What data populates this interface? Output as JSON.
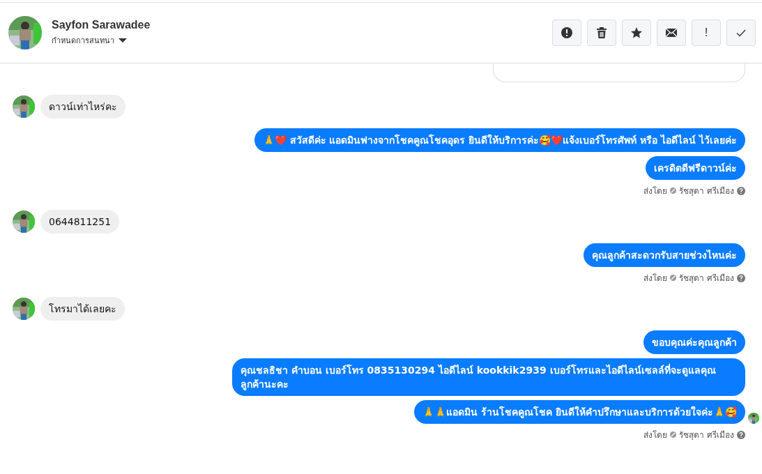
{
  "header": {
    "contact_name": "Sayfon Sarawadee",
    "subtitle": "กำหนดการสนทนา",
    "actions": [
      {
        "kind": "report"
      },
      {
        "kind": "trash"
      },
      {
        "kind": "star"
      },
      {
        "kind": "mail"
      },
      {
        "kind": "exclaim",
        "label": "!"
      },
      {
        "kind": "check"
      }
    ]
  },
  "messages": [
    {
      "kind": "cut_card"
    },
    {
      "kind": "in",
      "parts": [
        {
          "text": "ดาวน์เท่าไหร่คะ"
        }
      ]
    },
    {
      "kind": "out",
      "parts": [
        {
          "text": "🙏❤️ สวัสดีค่ะ แอดมินฟางจากโชคคูณโชคอุดร ยินดีให้บริการค่ะ🥰❤️แจ้งเบอร์โทรศัพท์ หรือ ไอดีไลน์  ไว้เลยค่ะ"
        }
      ]
    },
    {
      "kind": "out",
      "parts": [
        {
          "text": "เครดิตดีฟรีดาวน์ค่ะ"
        }
      ]
    },
    {
      "kind": "sent_by",
      "label": "ส่งโดย",
      "agent": "รัชสุดา ศรีเมือง"
    },
    {
      "kind": "in",
      "parts": [
        {
          "text": "0644811251"
        }
      ]
    },
    {
      "kind": "out",
      "parts": [
        {
          "text": "คุณลูกค้าสะดวกรับสายช่วงไหนค่ะ"
        }
      ]
    },
    {
      "kind": "sent_by",
      "label": "ส่งโดย",
      "agent": "รัชสุดา ศรีเมือง"
    },
    {
      "kind": "in",
      "parts": [
        {
          "text": "โทรมาได้เลยคะ"
        }
      ]
    },
    {
      "kind": "out",
      "parts": [
        {
          "text": "ขอบคุณค่ะคุณลูกค้า"
        }
      ]
    },
    {
      "kind": "out",
      "parts": [
        {
          "text": "คุณชลธิชา คำบอน เบอร์โทร 0835130294  ไอดีไลน์ kookkik2939   เบอร์โทรและไอดีไลน์เซลล์ที่จะดูแลคุณลูกค้านะคะ"
        }
      ]
    },
    {
      "kind": "out",
      "seen": true,
      "parts": [
        {
          "text": "🙏🙏แอดมิน ร้านโชคคูณโชค ยินดีให้คำปรึกษาและบริการด้วยใจค่ะ🙏🥰"
        }
      ]
    },
    {
      "kind": "sent_by",
      "label": "ส่งโดย",
      "agent": "รัชสุดา ศรีเมือง"
    }
  ]
}
